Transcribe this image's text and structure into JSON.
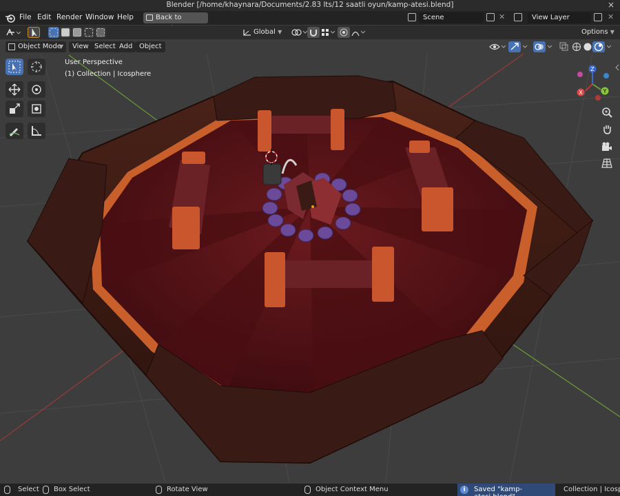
{
  "window": {
    "title": "Blender [/home/khaynara/Documents/2.83 lts/12 saatli oyun/kamp-atesi.blend]",
    "close_glyph": "×"
  },
  "menubar": {
    "items": [
      "File",
      "Edit",
      "Render",
      "Window",
      "Help"
    ],
    "back_button": "Back to Previous",
    "scene_field": "Scene",
    "view_layer_field": "View Layer"
  },
  "header": {
    "transform_orientation": "Global",
    "options_label": "Options"
  },
  "viewport_header": {
    "mode": "Object Mode",
    "menus": [
      "View",
      "Select",
      "Add",
      "Object"
    ]
  },
  "viewport": {
    "perspective_label": "User Perspective",
    "collection_label": "(1) Collection | Icosphere",
    "gizmo_axes": [
      "X",
      "Y",
      "Z"
    ]
  },
  "statusbar": {
    "select": "Select",
    "box_select": "Box Select",
    "rotate_view": "Rotate View",
    "context_menu": "Object Context Menu",
    "saved": "Saved \"kamp-atesi.blend\"",
    "info_glyph": "i",
    "collection_info": "Collection | Icosphe"
  },
  "colors": {
    "accent": "#4772b3",
    "frame_dark": "#3a1a14",
    "frame_orange": "#c9602c",
    "floor": "#5a1418"
  }
}
